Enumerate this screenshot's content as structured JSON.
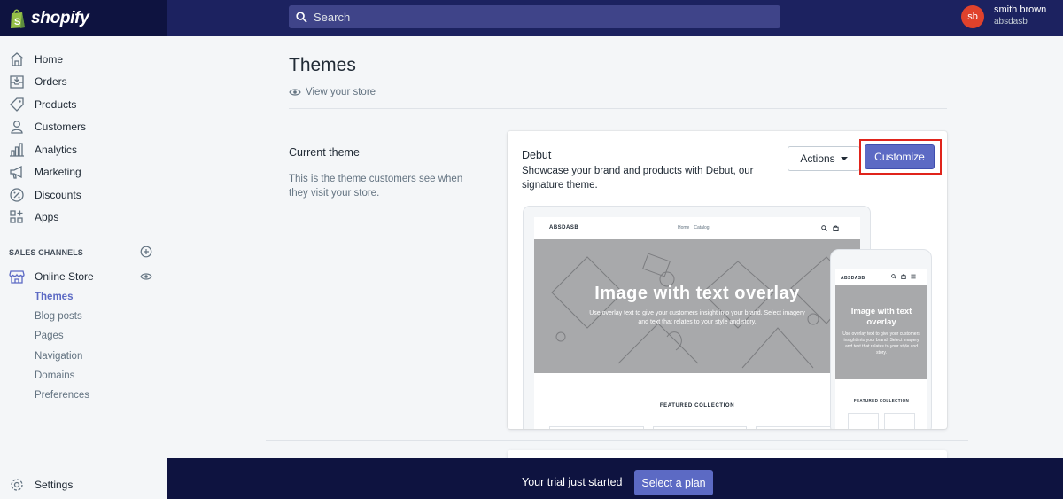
{
  "brand": {
    "name": "shopify"
  },
  "topbar": {
    "search_placeholder": "Search"
  },
  "user": {
    "initials": "sb",
    "name": "smith brown",
    "store": "absdasb"
  },
  "sidebar": {
    "items": [
      {
        "label": "Home",
        "icon": "home-icon"
      },
      {
        "label": "Orders",
        "icon": "orders-icon"
      },
      {
        "label": "Products",
        "icon": "tag-icon"
      },
      {
        "label": "Customers",
        "icon": "person-icon"
      },
      {
        "label": "Analytics",
        "icon": "bar-chart-icon"
      },
      {
        "label": "Marketing",
        "icon": "megaphone-icon"
      },
      {
        "label": "Discounts",
        "icon": "discount-icon"
      },
      {
        "label": "Apps",
        "icon": "apps-icon"
      }
    ],
    "sales_channels_label": "SALES CHANNELS",
    "online_store": "Online Store",
    "subitems": [
      "Themes",
      "Blog posts",
      "Pages",
      "Navigation",
      "Domains",
      "Preferences"
    ],
    "active_subitem": "Themes",
    "settings": "Settings"
  },
  "main": {
    "title": "Themes",
    "view_store": "View your store",
    "current_theme": {
      "section_title": "Current theme",
      "section_desc": "This is the theme customers see when they visit your store.",
      "theme_name": "Debut",
      "theme_desc": "Showcase your brand and products with Debut, our signature theme.",
      "actions_label": "Actions",
      "customize_label": "Customize"
    },
    "preview": {
      "store_name": "ABSDASB",
      "nav": [
        "Home",
        "Catalog"
      ],
      "hero_title": "Image with text overlay",
      "hero_text": "Use overlay text to give your customers insight into your brand. Select imagery and text that relates to your style and story.",
      "featured": "FEATURED COLLECTION"
    }
  },
  "banner": {
    "trial_text": "Your trial just started",
    "plan_button": "Select a plan"
  },
  "colors": {
    "topbar": "#1c2260",
    "brand_dark": "#0e1340",
    "accent": "#5c6ac4",
    "avatar": "#e0422c",
    "highlight": "#e0241b"
  }
}
